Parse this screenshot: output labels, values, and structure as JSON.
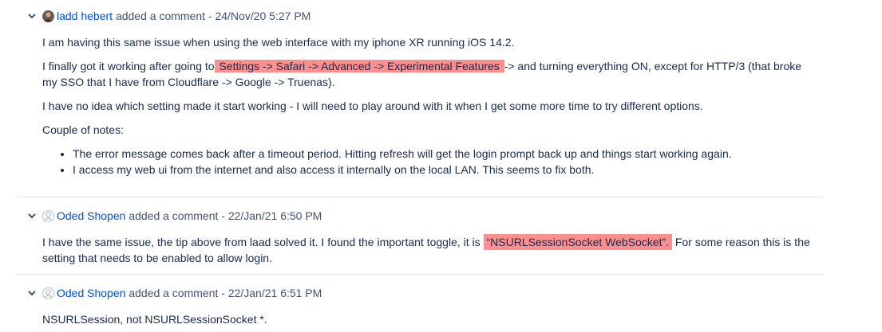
{
  "comments": [
    {
      "author": "ladd hebert",
      "action": " added a comment - ",
      "timestamp": "24/Nov/20 5:27 PM",
      "avatar": "user-photo",
      "para1": "I am having this same issue when using the web interface with my iphone XR running iOS 14.2.",
      "para2_pre": "I finally got it working after going to",
      "para2_highlight": " Settings -> Safari -> Advanced -> Experimental Features ",
      "para2_post": "-> and turning everything ON, except for HTTP/3 (that broke my SSO that I have from Cloudflare -> Google -> Truenas).",
      "para3": "I have no idea which setting made it start working - I will need to play around with it when I get some more time to try different options.",
      "para4": "Couple of notes:",
      "notes": [
        "The error message comes back after a timeout period. Hitting refresh will get the login prompt back up and things start working again.",
        "I access my web ui from the internet and also access it internally on the local LAN. This seems to fix both."
      ]
    },
    {
      "author": "Oded Shopen",
      "action": " added a comment - ",
      "timestamp": "22/Jan/21 6:50 PM",
      "avatar": "default-user",
      "para1_pre": "I have the same issue, the tip above from laad solved it. I found the important toggle, it is ",
      "para1_highlight": "“NSURLSessionSocket WebSocket”.",
      "para1_post": " For some reason this is the setting that needs to be enabled to allow login."
    },
    {
      "author": "Oded Shopen",
      "action": " added a comment - ",
      "timestamp": "22/Jan/21 6:51 PM",
      "avatar": "default-user",
      "para1": "NSURLSession, not NSURLSessionSocket *."
    }
  ],
  "colors": {
    "link": "#0052cc",
    "highlight": "#ff8f8f",
    "divider": "#dfe1e6",
    "text": "#172b4d"
  }
}
